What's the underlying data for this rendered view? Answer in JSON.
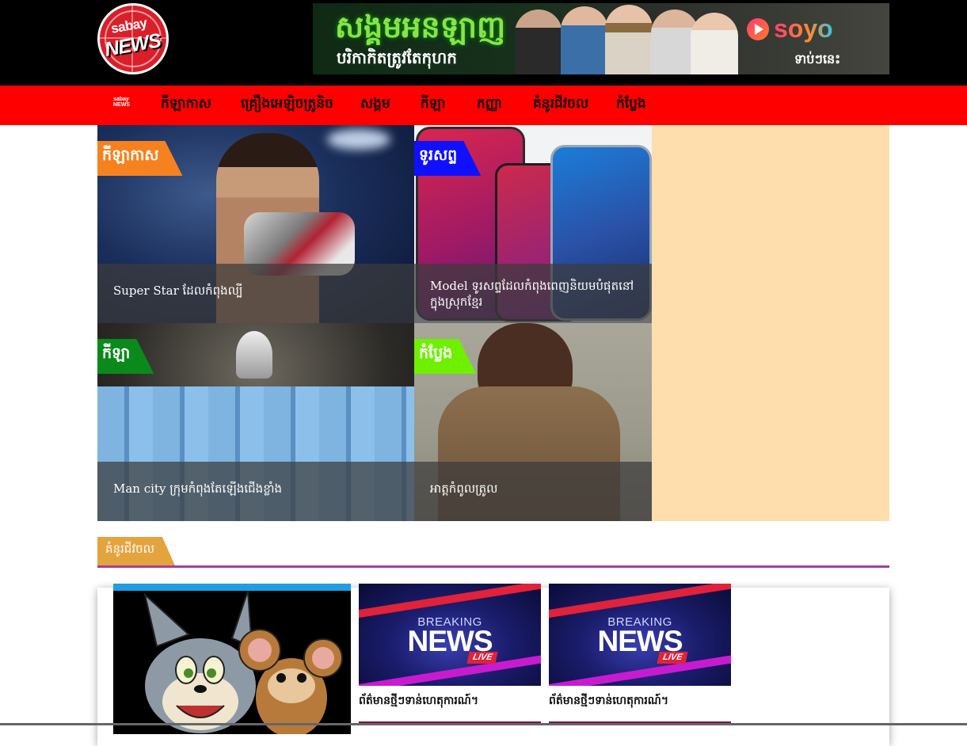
{
  "header": {
    "logo_top": "sabay",
    "logo_bottom": "NEWS",
    "banner": {
      "title": "សង្គមអនឡាញ",
      "subtitle": "បរិកាកិតត្រូវតែកុហក",
      "brand": "soyo",
      "cta": "ទាប់ៗនេះ"
    }
  },
  "nav": {
    "logo_text": "sabay NEWS",
    "items": [
      {
        "label": "កីឡាកាស"
      },
      {
        "label": "គ្រឿងអេឡិចត្រូនិច"
      },
      {
        "label": "សង្គម"
      },
      {
        "label": "កីឡា"
      },
      {
        "label": "កញ្ញា"
      },
      {
        "label": "គំនូរជីវចល"
      },
      {
        "label": "កំប្លែង"
      }
    ]
  },
  "featured": [
    {
      "category": "កីឡាកាស",
      "caption": "Super Star ដែលកំពុងល្បី",
      "category_color": "#f5821f"
    },
    {
      "category": "ទូរសព្ទ",
      "caption": "Model ទូរសព្ទដែលកំពុងពេញនិយមបំផុតនៅក្នុងស្រុកខ្មែរ",
      "category_color": "#1010ff"
    },
    {
      "category": "កីឡា",
      "caption": "Man city ក្រុមកំពុងតែឡើងជើងខ្លាំង",
      "category_color": "#0a8a1a"
    },
    {
      "category": "កំប្លែង",
      "caption": "អាត្តកំពូលត្រូល",
      "category_color": "#6ef000"
    }
  ],
  "section": {
    "title": "គំនូរជីវចល",
    "cards": [
      {
        "title": "ព័ត៌មានថ្មីៗទាន់ហេតុការណ៍។",
        "image_top": "BREAKING",
        "image_main": "NEWS",
        "image_tag": "LIVE"
      },
      {
        "title": "ព័ត៌មានថ្មីៗទាន់ហេតុការណ៍។",
        "image_top": "BREAKING",
        "image_main": "NEWS",
        "image_tag": "LIVE"
      }
    ]
  },
  "colors": {
    "nav_bg": "#ff0000",
    "section_accent": "#e4a43d",
    "section_rule": "#a43ea2",
    "side_ad_bg": "#ffdead"
  }
}
